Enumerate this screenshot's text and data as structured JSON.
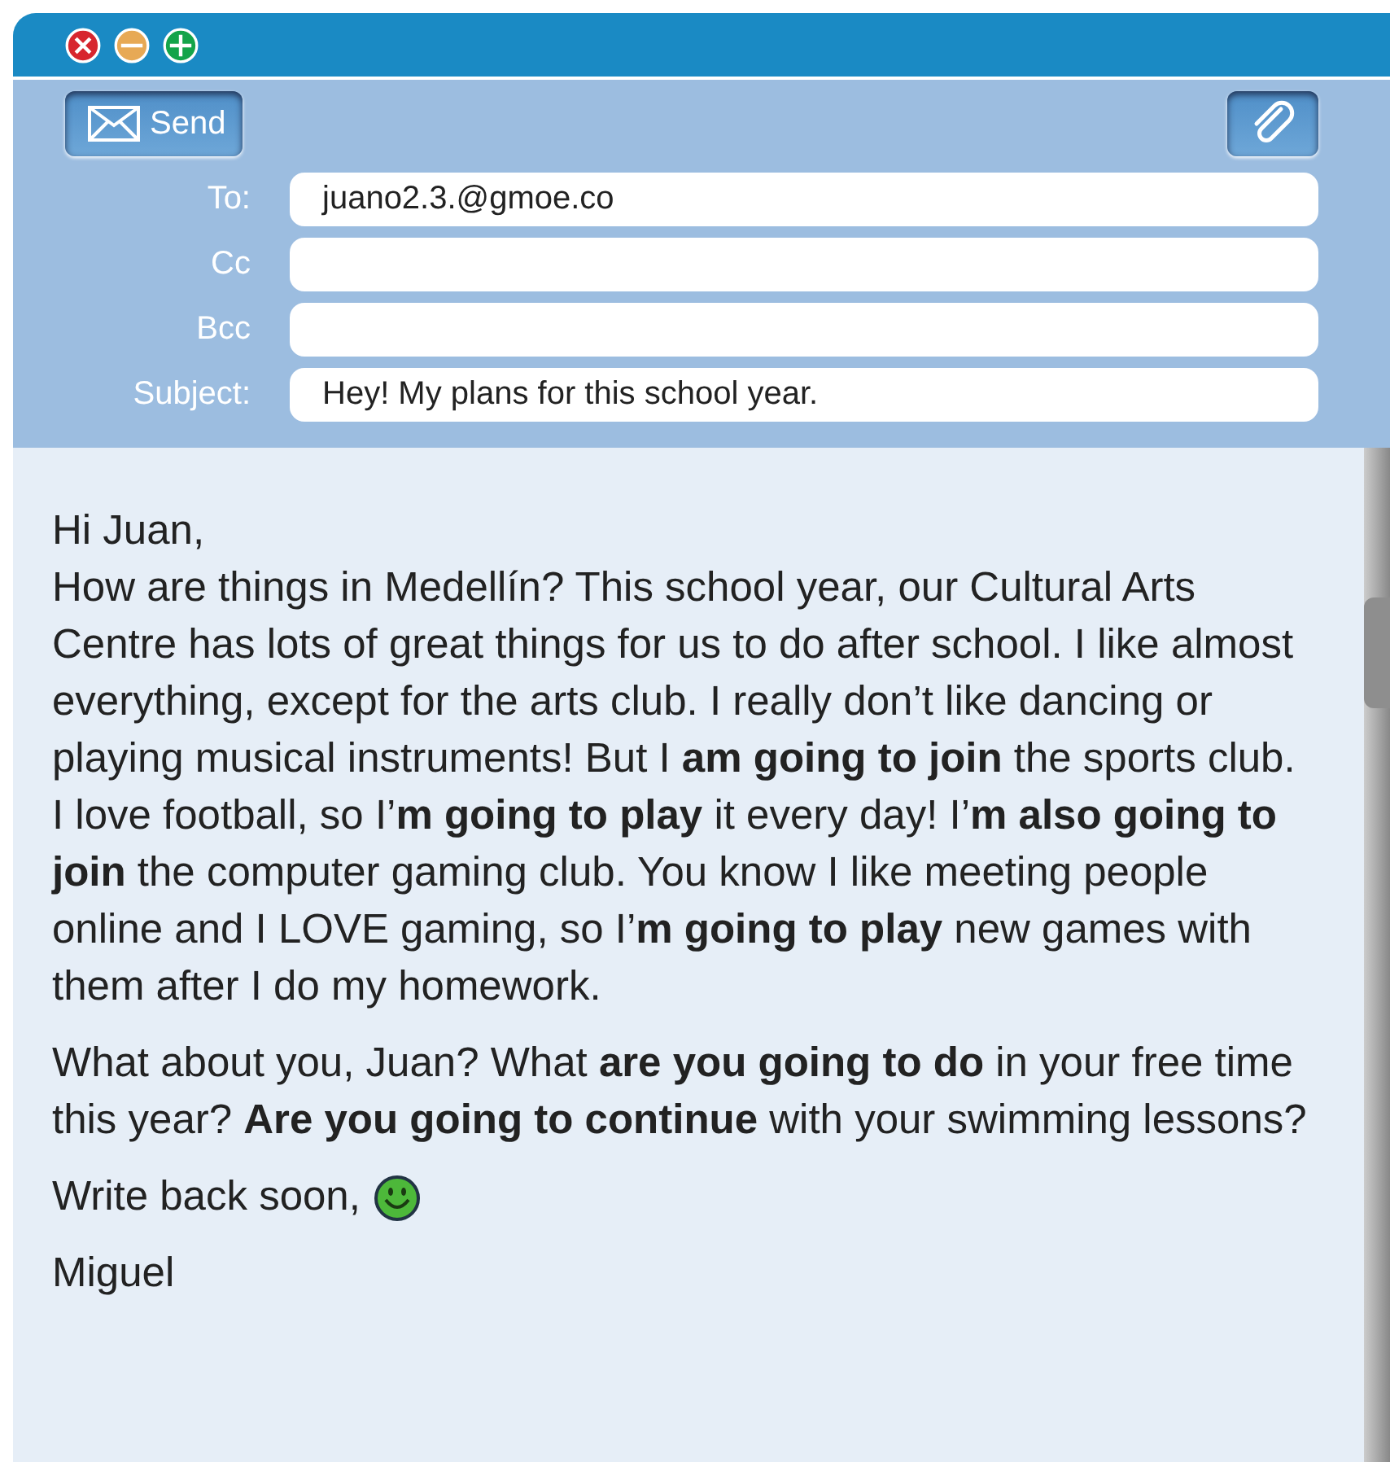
{
  "toolbar": {
    "send_button": "Send"
  },
  "fields": [
    {
      "label": "To:",
      "value": "juano2.3.@gmoe.co"
    },
    {
      "label": "Cc"
    },
    {
      "label": "Bcc"
    },
    {
      "label": "Subject:",
      "value": "Hey! My plans for this school year."
    }
  ],
  "body": {
    "greeting": "Hi Juan,",
    "paragraphs": [
      "How are things in Medellín? This school year, our Cultural Arts Centre has lots of great things for us to do after school. I like almost everything, except for the arts club. I really don’t like dancing or playing musical instruments! But I **am going to join** the sports club. I love football, so I’**m going to play** it every day! I’**m also going to join** the computer gaming club. You know I like meeting people online and I LOVE gaming, so I’**m going to play** new games with them after I do my homework.",
      "What about you, Juan? What **are you going to do** in your free time this year? **Are you going to continue** with your swimming lessons?"
    ],
    "closing": "Write back soon,",
    "signature": "Miguel"
  }
}
